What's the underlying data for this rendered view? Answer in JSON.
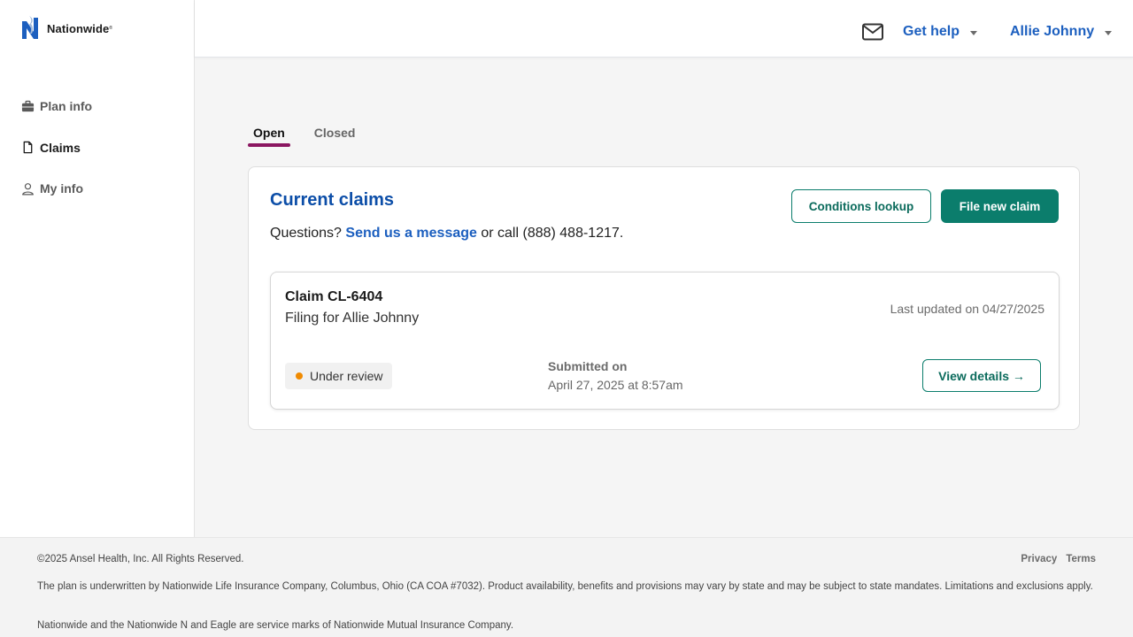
{
  "brand": {
    "name": "Nationwide",
    "registered": "®",
    "color": "#1c5fbf"
  },
  "sidebar": {
    "items": [
      {
        "label": "Plan info",
        "icon": "briefcase-icon",
        "active": false
      },
      {
        "label": "Claims",
        "icon": "document-icon",
        "active": true
      },
      {
        "label": "My info",
        "icon": "user-icon",
        "active": false
      }
    ]
  },
  "header": {
    "mail_icon": "envelope-icon",
    "help_label": "Get help",
    "user_label": "Allie Johnny"
  },
  "tabs": [
    {
      "label": "Open",
      "active": true
    },
    {
      "label": "Closed",
      "active": false
    }
  ],
  "claims_card": {
    "title": "Current claims",
    "questions_prefix": "Questions?",
    "message_link": "Send us a message",
    "questions_suffix": "or call (888) 488-1217.",
    "conditions_button": "Conditions lookup",
    "file_button": "File new claim",
    "accent_color": "#0b7d6c"
  },
  "claim": {
    "title": "Claim CL-6404",
    "subtitle": "Filing for Allie Johnny",
    "last_updated": "Last updated on 04/27/2025",
    "status": "Under review",
    "status_color": "#f08a00",
    "submitted_label": "Submitted on",
    "submitted_value": "April 27, 2025 at 8:57am",
    "details_button": "View details →"
  },
  "footer": {
    "copyright": "©2025 Ansel Health, Inc. All Rights Reserved.",
    "links": [
      "Privacy",
      "Terms"
    ],
    "disclaimer": "The plan is underwritten by Nationwide Life Insurance Company, Columbus, Ohio (CA COA #7032). Product availability, benefits and provisions may vary by state and may be subject to state mandates. Limitations and exclusions apply.",
    "marks": "Nationwide and the Nationwide N and Eagle are service marks of Nationwide Mutual Insurance Company."
  }
}
